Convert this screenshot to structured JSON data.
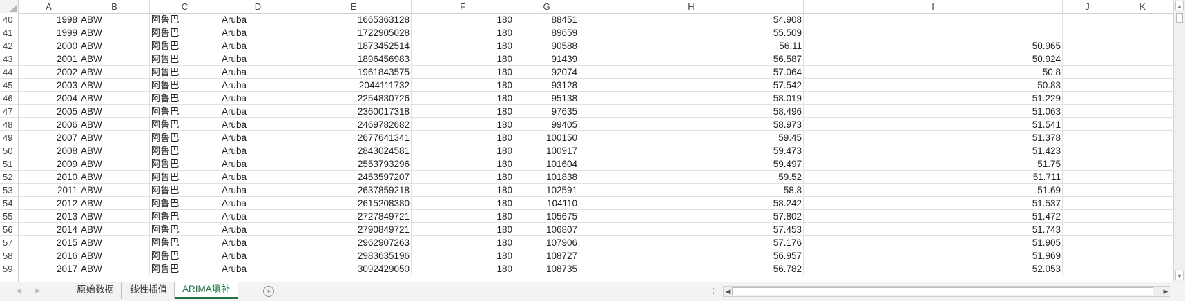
{
  "columns": [
    "A",
    "B",
    "C",
    "D",
    "E",
    "F",
    "G",
    "H",
    "I",
    "J",
    "K"
  ],
  "rows": [
    {
      "n": "40",
      "a": "1998",
      "b": "ABW",
      "c": "阿鲁巴",
      "d": "Aruba",
      "e": "1665363128",
      "f": "180",
      "g": "88451",
      "h": "54.908",
      "i": ""
    },
    {
      "n": "41",
      "a": "1999",
      "b": "ABW",
      "c": "阿鲁巴",
      "d": "Aruba",
      "e": "1722905028",
      "f": "180",
      "g": "89659",
      "h": "55.509",
      "i": ""
    },
    {
      "n": "42",
      "a": "2000",
      "b": "ABW",
      "c": "阿鲁巴",
      "d": "Aruba",
      "e": "1873452514",
      "f": "180",
      "g": "90588",
      "h": "56.11",
      "i": "50.965"
    },
    {
      "n": "43",
      "a": "2001",
      "b": "ABW",
      "c": "阿鲁巴",
      "d": "Aruba",
      "e": "1896456983",
      "f": "180",
      "g": "91439",
      "h": "56.587",
      "i": "50.924"
    },
    {
      "n": "44",
      "a": "2002",
      "b": "ABW",
      "c": "阿鲁巴",
      "d": "Aruba",
      "e": "1961843575",
      "f": "180",
      "g": "92074",
      "h": "57.064",
      "i": "50.8"
    },
    {
      "n": "45",
      "a": "2003",
      "b": "ABW",
      "c": "阿鲁巴",
      "d": "Aruba",
      "e": "2044111732",
      "f": "180",
      "g": "93128",
      "h": "57.542",
      "i": "50.83"
    },
    {
      "n": "46",
      "a": "2004",
      "b": "ABW",
      "c": "阿鲁巴",
      "d": "Aruba",
      "e": "2254830726",
      "f": "180",
      "g": "95138",
      "h": "58.019",
      "i": "51.229"
    },
    {
      "n": "47",
      "a": "2005",
      "b": "ABW",
      "c": "阿鲁巴",
      "d": "Aruba",
      "e": "2360017318",
      "f": "180",
      "g": "97635",
      "h": "58.496",
      "i": "51.063"
    },
    {
      "n": "48",
      "a": "2006",
      "b": "ABW",
      "c": "阿鲁巴",
      "d": "Aruba",
      "e": "2469782682",
      "f": "180",
      "g": "99405",
      "h": "58.973",
      "i": "51.541"
    },
    {
      "n": "49",
      "a": "2007",
      "b": "ABW",
      "c": "阿鲁巴",
      "d": "Aruba",
      "e": "2677641341",
      "f": "180",
      "g": "100150",
      "h": "59.45",
      "i": "51.378"
    },
    {
      "n": "50",
      "a": "2008",
      "b": "ABW",
      "c": "阿鲁巴",
      "d": "Aruba",
      "e": "2843024581",
      "f": "180",
      "g": "100917",
      "h": "59.473",
      "i": "51.423"
    },
    {
      "n": "51",
      "a": "2009",
      "b": "ABW",
      "c": "阿鲁巴",
      "d": "Aruba",
      "e": "2553793296",
      "f": "180",
      "g": "101604",
      "h": "59.497",
      "i": "51.75"
    },
    {
      "n": "52",
      "a": "2010",
      "b": "ABW",
      "c": "阿鲁巴",
      "d": "Aruba",
      "e": "2453597207",
      "f": "180",
      "g": "101838",
      "h": "59.52",
      "i": "51.711"
    },
    {
      "n": "53",
      "a": "2011",
      "b": "ABW",
      "c": "阿鲁巴",
      "d": "Aruba",
      "e": "2637859218",
      "f": "180",
      "g": "102591",
      "h": "58.8",
      "i": "51.69"
    },
    {
      "n": "54",
      "a": "2012",
      "b": "ABW",
      "c": "阿鲁巴",
      "d": "Aruba",
      "e": "2615208380",
      "f": "180",
      "g": "104110",
      "h": "58.242",
      "i": "51.537"
    },
    {
      "n": "55",
      "a": "2013",
      "b": "ABW",
      "c": "阿鲁巴",
      "d": "Aruba",
      "e": "2727849721",
      "f": "180",
      "g": "105675",
      "h": "57.802",
      "i": "51.472"
    },
    {
      "n": "56",
      "a": "2014",
      "b": "ABW",
      "c": "阿鲁巴",
      "d": "Aruba",
      "e": "2790849721",
      "f": "180",
      "g": "106807",
      "h": "57.453",
      "i": "51.743"
    },
    {
      "n": "57",
      "a": "2015",
      "b": "ABW",
      "c": "阿鲁巴",
      "d": "Aruba",
      "e": "2962907263",
      "f": "180",
      "g": "107906",
      "h": "57.176",
      "i": "51.905"
    },
    {
      "n": "58",
      "a": "2016",
      "b": "ABW",
      "c": "阿鲁巴",
      "d": "Aruba",
      "e": "2983635196",
      "f": "180",
      "g": "108727",
      "h": "56.957",
      "i": "51.969"
    },
    {
      "n": "59",
      "a": "2017",
      "b": "ABW",
      "c": "阿鲁巴",
      "d": "Aruba",
      "e": "3092429050",
      "f": "180",
      "g": "108735",
      "h": "56.782",
      "i": "52.053"
    }
  ],
  "sheet_tabs": [
    {
      "label": "原始数据",
      "active": false
    },
    {
      "label": "线性插值",
      "active": false
    },
    {
      "label": "ARIMA填补",
      "active": true
    }
  ],
  "icons": {
    "add_sheet": "plus-circle-icon",
    "scroll_up": "chevron-up-icon",
    "scroll_down": "chevron-down-icon",
    "scroll_left": "chevron-left-icon",
    "scroll_right": "chevron-right-icon",
    "tab_prev": "tab-prev-icon",
    "tab_next": "tab-next-icon"
  },
  "colors": {
    "active_tab": "#1e7145",
    "gridline": "#e1e1e1"
  }
}
